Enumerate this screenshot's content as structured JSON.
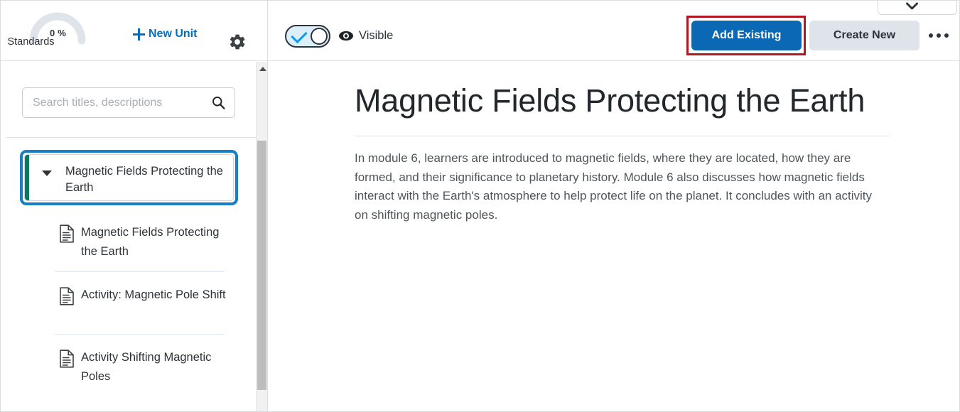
{
  "sidebar": {
    "gauge": {
      "percent": "0 %",
      "label": "Standards",
      "track_color": "#dee4ea",
      "value": 0
    },
    "new_unit_label": "New Unit",
    "gear_icon": "gear-icon",
    "search": {
      "value": "",
      "placeholder": "Search titles, descriptions",
      "icon": "search-icon"
    },
    "unit": {
      "title": "Magnetic Fields Protecting the Earth",
      "expanded": true,
      "selected": true,
      "accent_color": "#06795f",
      "focus_color": "#1a7ec6",
      "caret_icon": "caret-down-icon"
    },
    "items": [
      {
        "label": "Magnetic Fields Protecting the Earth",
        "icon": "document-icon"
      },
      {
        "label": "Activity: Magnetic Pole Shift",
        "icon": "document-icon"
      },
      {
        "label": "Activity Shifting Magnetic Poles",
        "icon": "document-icon"
      }
    ],
    "scrollbar": {
      "up_icon": "scroll-up-arrow-icon"
    }
  },
  "toolbar": {
    "visibility_toggle": {
      "state": "on",
      "icon": "check-icon"
    },
    "eye_icon": "eye-icon",
    "visible_label": "Visible",
    "top_dropdown_icon": "chevron-down-icon",
    "add_existing_label": "Add Existing",
    "create_new_label": "Create New",
    "overflow_icon": "more-horizontal-icon",
    "add_existing_color": "#0a68b4",
    "create_new_color": "#dfe4ea",
    "highlight_color": "#b31622"
  },
  "main": {
    "title": "Magnetic Fields Protecting the Earth",
    "description": "In module 6, learners are introduced to magnetic fields, where they are located, how they are formed, and their significance to planetary history. Module 6 also discusses how magnetic fields interact with the Earth's atmosphere to help protect life on the planet. It concludes with an activity on shifting magnetic poles."
  }
}
